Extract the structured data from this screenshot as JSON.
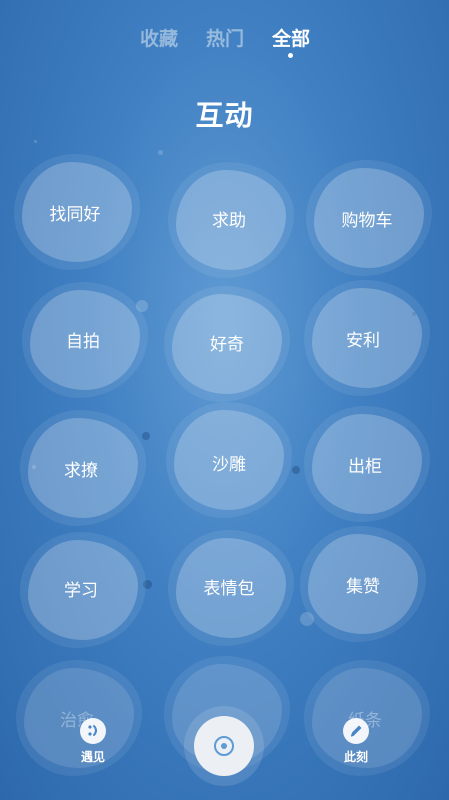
{
  "tabs": [
    {
      "label": "收藏"
    },
    {
      "label": "热门"
    },
    {
      "label": "全部"
    }
  ],
  "title": "互动",
  "bubbles": [
    {
      "label": "找同好"
    },
    {
      "label": "求助"
    },
    {
      "label": "购物车"
    },
    {
      "label": "自拍"
    },
    {
      "label": "好奇"
    },
    {
      "label": "安利"
    },
    {
      "label": "求撩"
    },
    {
      "label": "沙雕"
    },
    {
      "label": "出柜"
    },
    {
      "label": "学习"
    },
    {
      "label": "表情包"
    },
    {
      "label": "集赞"
    },
    {
      "label": "治愈"
    },
    {
      "label": "纸条"
    }
  ],
  "nav": {
    "left_label": "遇见",
    "right_label": "此刻",
    "left_icon": "smile-icon",
    "center_icon": "record-icon",
    "right_icon": "pencil-icon"
  },
  "colors": {
    "accent": "#5d9bd6",
    "background": "#3f7fc2"
  }
}
